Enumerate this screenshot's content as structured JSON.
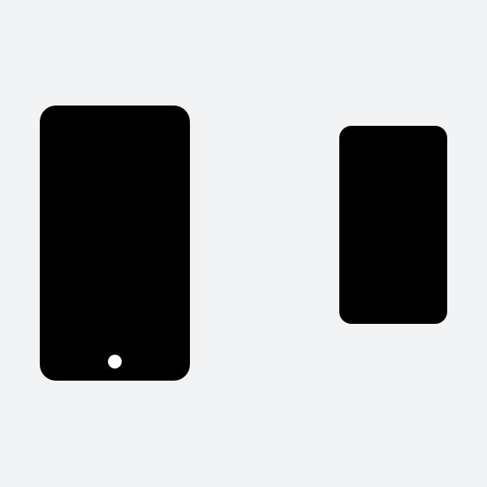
{
  "scene": {
    "background_color": "#f2f3f5",
    "device_color": "#000000",
    "button_color": "#ffffff"
  },
  "devices": [
    {
      "icon": "phone-with-home-button-icon"
    },
    {
      "icon": "phone-icon"
    }
  ]
}
